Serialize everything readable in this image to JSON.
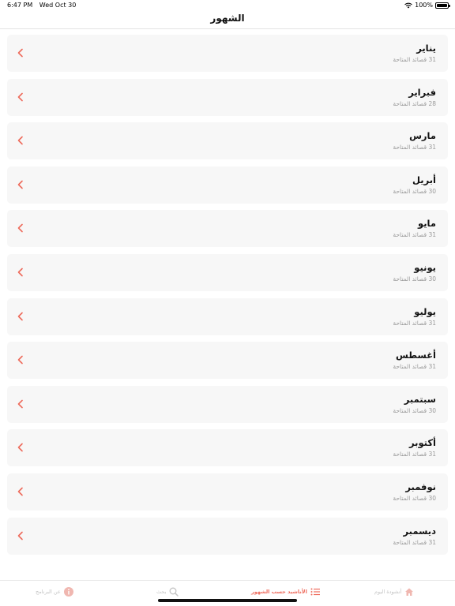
{
  "status_bar": {
    "time": "6:47 PM",
    "date": "Wed Oct 30",
    "battery": "100%",
    "battery_level": 1.0
  },
  "nav": {
    "title": "الشهور"
  },
  "months": [
    {
      "name": "يناير",
      "count": "31 قصائد المتاحة"
    },
    {
      "name": "فبراير",
      "count": "28 قصائد المتاحة"
    },
    {
      "name": "مارس",
      "count": "31 قصائد المتاحة"
    },
    {
      "name": "أبريل",
      "count": "30 قصائد المتاحة"
    },
    {
      "name": "مايو",
      "count": "31 قصائد المتاحة"
    },
    {
      "name": "يونيو",
      "count": "30 قصائد المتاحة"
    },
    {
      "name": "يوليو",
      "count": "31 قصائد المتاحة"
    },
    {
      "name": "أغسطس",
      "count": "31 قصائد المتاحة"
    },
    {
      "name": "سبتمبر",
      "count": "30 قصائد المتاحة"
    },
    {
      "name": "أكتوبر",
      "count": "31 قصائد المتاحة"
    },
    {
      "name": "نوفمبر",
      "count": "30 قصائد المتاحة"
    },
    {
      "name": "ديسمبر",
      "count": "31 قصائد المتاحة"
    }
  ],
  "tabs": {
    "home": {
      "label": "أنشودة اليوم",
      "icon": "home-icon"
    },
    "months": {
      "label": "الأناشيد حسب الشهور",
      "icon": "list-icon"
    },
    "search": {
      "label": "بحث",
      "icon": "search-icon"
    },
    "about": {
      "label": "عن البرنامج",
      "icon": "info-icon"
    }
  },
  "colors": {
    "accent": "#ee6b5c",
    "row_bg": "#f7f7f7",
    "inactive": "#c4c4c4"
  }
}
